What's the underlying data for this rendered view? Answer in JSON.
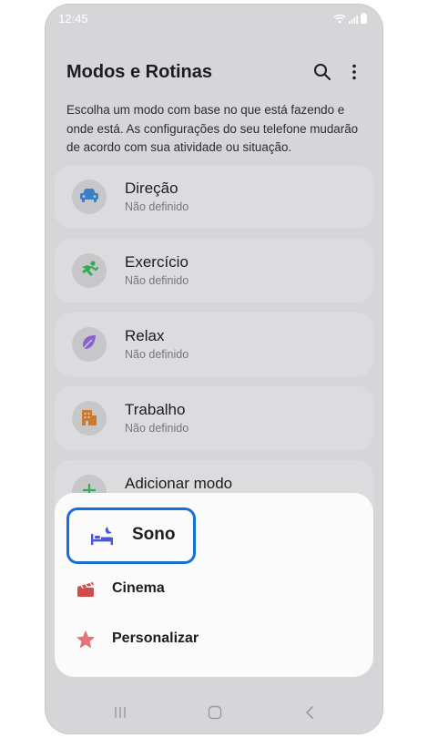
{
  "status": {
    "time": "12:45"
  },
  "header": {
    "title": "Modos e Rotinas",
    "search_icon": "search-icon",
    "more_icon": "more-vertical-icon"
  },
  "description": "Escolha um modo com base no que está fazendo e onde está. As configurações do seu telefone mudarão de acordo com sua atividade ou situação.",
  "modes": [
    {
      "title": "Direção",
      "subtitle": "Não definido",
      "icon": "car-icon",
      "color": "#3d7fc4"
    },
    {
      "title": "Exercício",
      "subtitle": "Não definido",
      "icon": "running-icon",
      "color": "#2fae57"
    },
    {
      "title": "Relax",
      "subtitle": "Não definido",
      "icon": "leaf-icon",
      "color": "#8a5fd0"
    },
    {
      "title": "Trabalho",
      "subtitle": "Não definido",
      "icon": "building-icon",
      "color": "#c97a2e"
    },
    {
      "title": "Adicionar modo",
      "subtitle": "",
      "icon": "plus-icon",
      "color": "#2fae57"
    }
  ],
  "popup": {
    "items": [
      {
        "label": "Sono",
        "icon": "bed-moon-icon",
        "color": "#4a56d6",
        "highlighted": true
      },
      {
        "label": "Cinema",
        "icon": "clapperboard-icon",
        "color": "#d24b4b"
      },
      {
        "label": "Personalizar",
        "icon": "star-icon",
        "color": "#e8727a"
      }
    ]
  },
  "accent_color": "#1a6fd6"
}
